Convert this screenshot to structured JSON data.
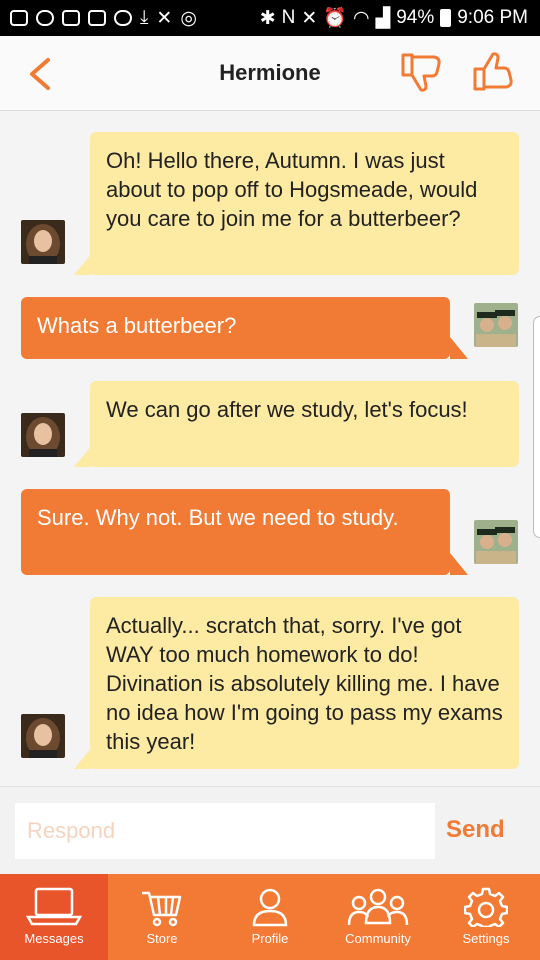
{
  "status_bar": {
    "battery": "94%",
    "time": "9:06 PM"
  },
  "header": {
    "title": "Hermione"
  },
  "messages": [
    {
      "from": "Hermione",
      "text": "Oh! Hello there, Autumn. I was just about to pop off to Hogsmeade, would you care to join me for a butterbeer?"
    },
    {
      "from": "me",
      "text": "Whats a butterbeer?"
    },
    {
      "from": "Hermione",
      "text": "We can go after we study, let's focus!"
    },
    {
      "from": "me",
      "text": "Sure. Why not. But we need to study."
    },
    {
      "from": "Hermione",
      "text": "Actually... scratch that, sorry. I've got WAY too much homework to do! Divination is absolutely killing me. I have no idea how I'm going to pass my exams this year!"
    }
  ],
  "respond": {
    "placeholder": "Respond",
    "value": "",
    "send_label": "Send"
  },
  "nav": {
    "items": [
      {
        "label": "Messages",
        "icon": "messages-icon"
      },
      {
        "label": "Store",
        "icon": "cart-icon"
      },
      {
        "label": "Profile",
        "icon": "user-icon"
      },
      {
        "label": "Community",
        "icon": "community-icon"
      },
      {
        "label": "Settings",
        "icon": "gear-icon"
      }
    ]
  },
  "colors": {
    "accent": "#f17a34",
    "bubble_other": "#fdeaa3",
    "nav_active": "#e8552a"
  }
}
